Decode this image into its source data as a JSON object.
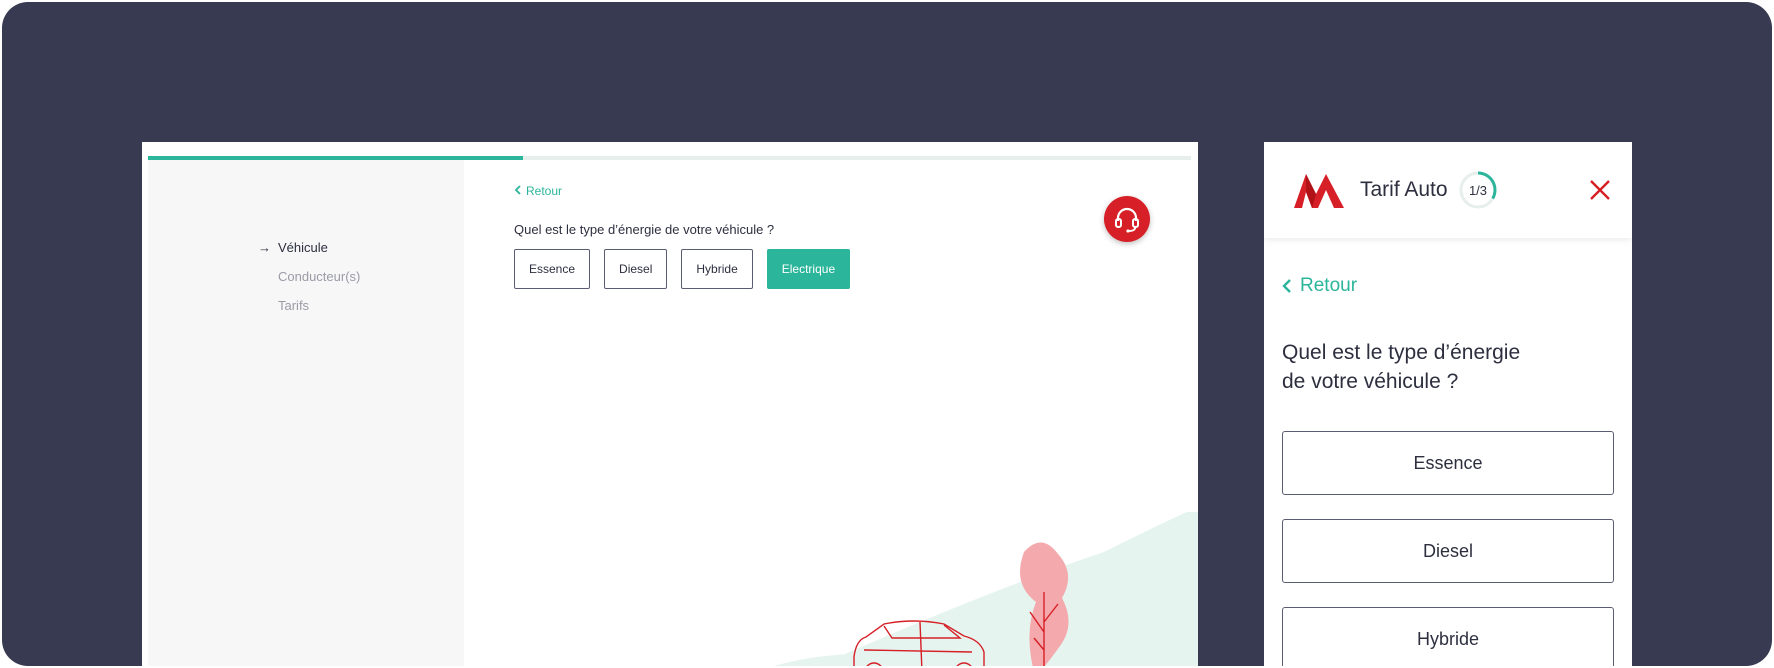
{
  "progress_percent": 36,
  "accent_color": "#2bb59b",
  "brand_color": "#d61f26",
  "desktop": {
    "nav": {
      "items": [
        {
          "label": "Véhicule",
          "active": true
        },
        {
          "label": "Conducteur(s)",
          "active": false
        },
        {
          "label": "Tarifs",
          "active": false
        }
      ]
    },
    "back_label": "Retour",
    "question": "Quel est le type d’énergie de votre véhicule ?",
    "options": [
      {
        "label": "Essence",
        "selected": false
      },
      {
        "label": "Diesel",
        "selected": false
      },
      {
        "label": "Hybride",
        "selected": false
      },
      {
        "label": "Electrique",
        "selected": true
      }
    ],
    "help_icon": "headset-icon"
  },
  "mobile": {
    "header": {
      "title": "Tarif Auto",
      "step": "1/3",
      "close_icon": "close-icon"
    },
    "back_label": "Retour",
    "question_line1": "Quel est le type d’énergie",
    "question_line2": "de votre véhicule ?",
    "options": [
      {
        "label": "Essence"
      },
      {
        "label": "Diesel"
      },
      {
        "label": "Hybride"
      }
    ]
  }
}
